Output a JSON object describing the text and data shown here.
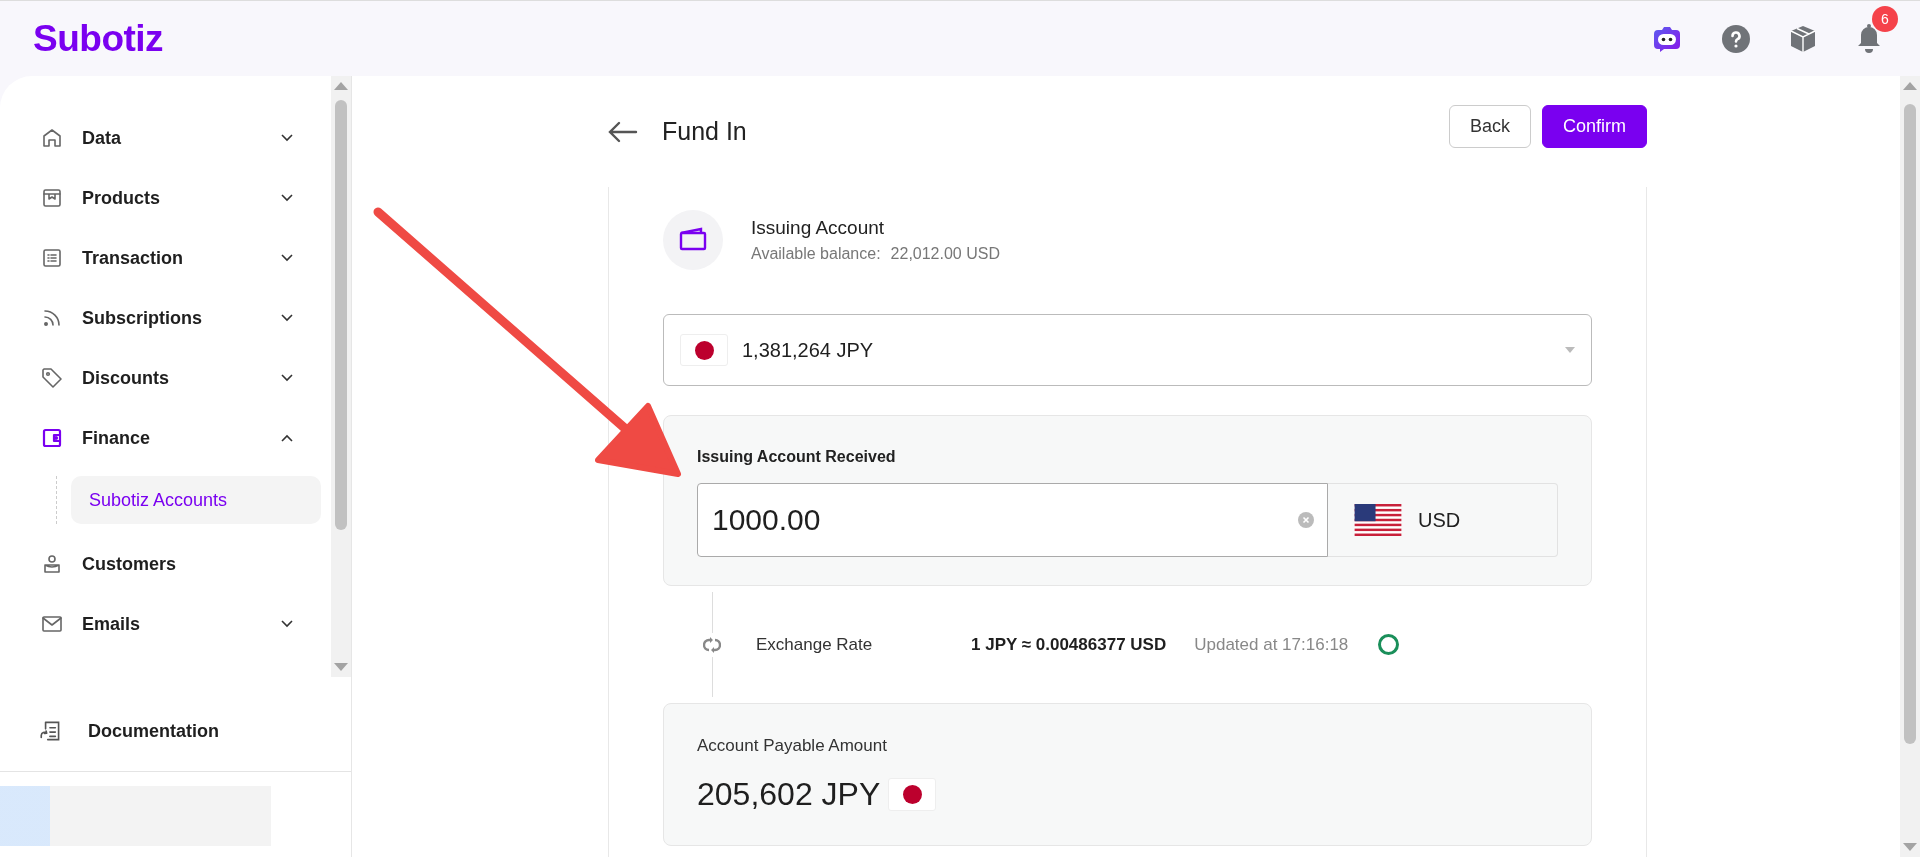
{
  "header": {
    "logo": "Subotiz",
    "notification_count": "6"
  },
  "sidebar": {
    "items": [
      {
        "label": "Data",
        "expandable": true,
        "expanded": false,
        "selected": false
      },
      {
        "label": "Products",
        "expandable": true,
        "expanded": false,
        "selected": false
      },
      {
        "label": "Transaction",
        "expandable": true,
        "expanded": false,
        "selected": false
      },
      {
        "label": "Subscriptions",
        "expandable": true,
        "expanded": false,
        "selected": false
      },
      {
        "label": "Discounts",
        "expandable": true,
        "expanded": false,
        "selected": false
      },
      {
        "label": "Finance",
        "expandable": true,
        "expanded": true,
        "selected": true,
        "children": [
          {
            "label": "Subotiz Accounts",
            "selected": true
          }
        ]
      },
      {
        "label": "Customers",
        "expandable": false,
        "expanded": false,
        "selected": false
      },
      {
        "label": "Emails",
        "expandable": true,
        "expanded": false,
        "selected": false
      }
    ],
    "footer_item": {
      "label": "Documentation"
    }
  },
  "page": {
    "title": "Fund In",
    "buttons": [
      {
        "label": "Back",
        "kind": "secondary"
      },
      {
        "label": "Confirm",
        "kind": "primary"
      }
    ]
  },
  "account": {
    "title": "Issuing Account",
    "balance_label": "Available balance:",
    "balance": "22,012.00 USD"
  },
  "source_select": {
    "value": "1,381,264 JPY"
  },
  "received": {
    "label": "Issuing Account Received",
    "value": "1000.00",
    "currency": "USD"
  },
  "exchange": {
    "label": "Exchange Rate",
    "rate": "1 JPY ≈ 0.00486377 USD",
    "updated": "Updated at 17:16:18"
  },
  "payable": {
    "label": "Account Payable Amount",
    "amount": "205,602 JPY"
  }
}
